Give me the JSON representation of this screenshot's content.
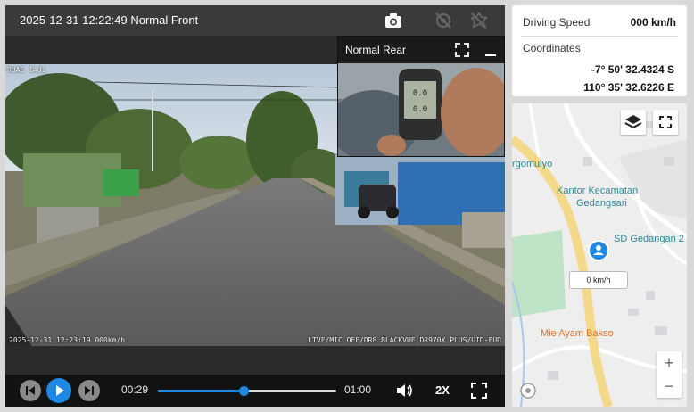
{
  "player": {
    "title": "2025-12-31 12:22:49 Normal Front",
    "rear_title": "Normal Rear",
    "overlay_top_left": "RUAS 1401",
    "overlay_bottom_left": "2025-12-31 12:23:19 000km/h",
    "overlay_bottom_right": "LTVF/MIC OFF/DR8 BLACKVUE DR970X PLUS/UID-FUD",
    "gps_readout_1": "0.0",
    "gps_readout_2": "0.0"
  },
  "controls": {
    "current_time": "00:29",
    "duration": "01:00",
    "progress_fraction": 0.48,
    "speed": "2X"
  },
  "info": {
    "speed_label": "Driving Speed",
    "speed_value": "000 km/h",
    "coords_label": "Coordinates",
    "latitude": "-7° 50' 32.4324 S",
    "longitude": "110° 35' 32.6226 E"
  },
  "map": {
    "place_1": "rgomulyo",
    "place_2": "Kantor Kecamatan",
    "place_3": "Gedangsari",
    "place_4": "SD Gedangan 2",
    "place_5": "Mie Ayam Bakso",
    "speed_bubble": "0 km/h",
    "zoom_in": "+",
    "zoom_out": "−"
  },
  "colors": {
    "accent": "#1e88e5",
    "road": "#f5d98a"
  },
  "icons": [
    "camera-icon",
    "gps-off-icon",
    "settings-off-icon",
    "expand-icon",
    "minimize-icon",
    "prev-icon",
    "play-icon",
    "next-icon",
    "volume-icon",
    "fullscreen-icon",
    "layers-icon",
    "map-fullscreen-icon",
    "location-pin-icon",
    "compass-icon"
  ]
}
